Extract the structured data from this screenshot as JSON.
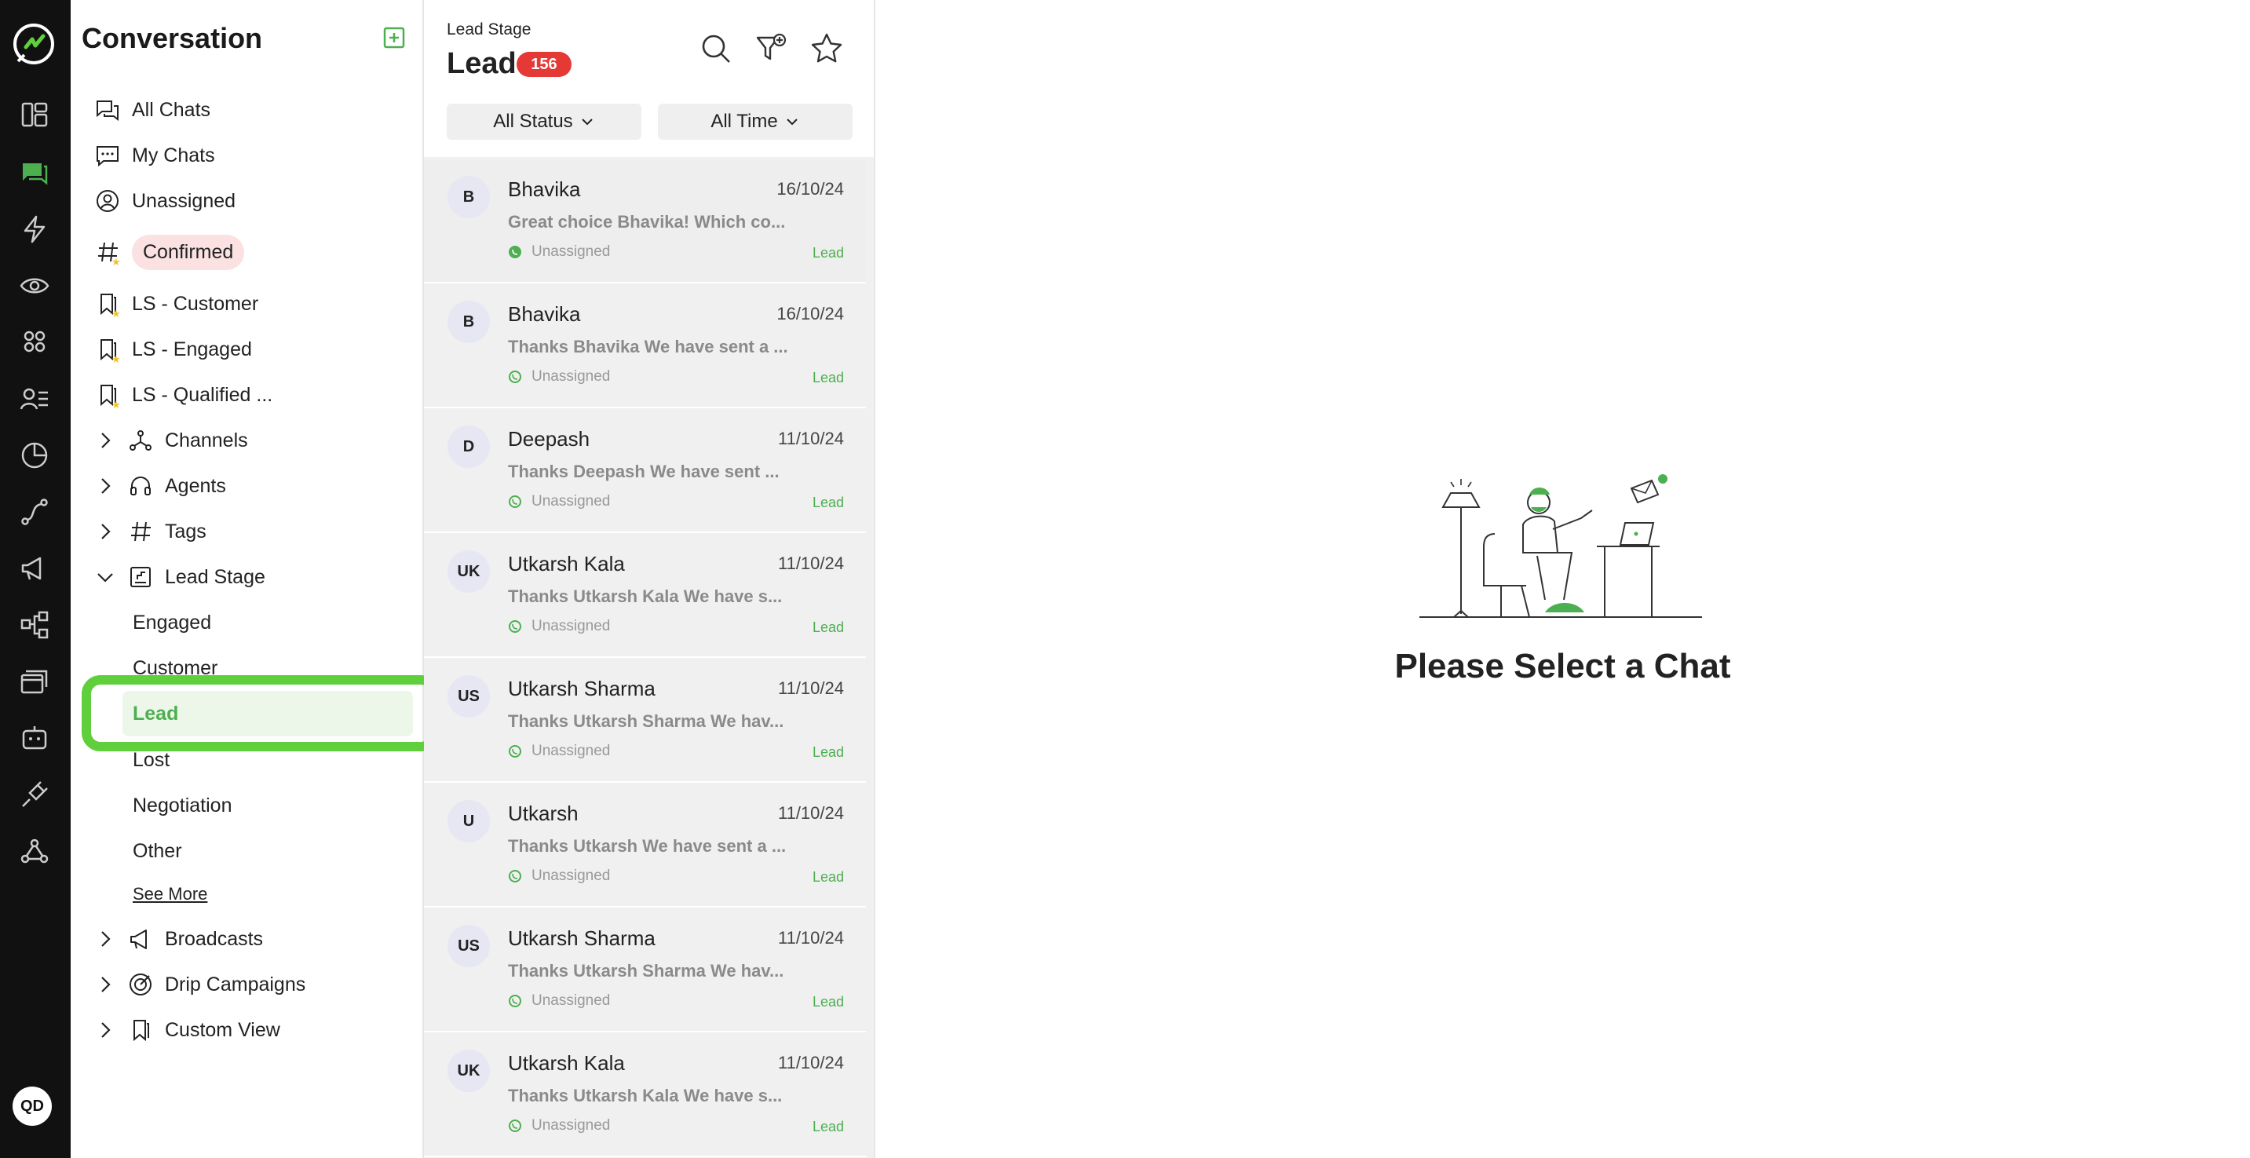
{
  "sidebar": {
    "title": "Conversation",
    "items": [
      {
        "label": "All Chats"
      },
      {
        "label": "My Chats"
      },
      {
        "label": "Unassigned"
      },
      {
        "label": "Confirmed"
      },
      {
        "label": "LS - Customer"
      },
      {
        "label": "LS - Engaged"
      },
      {
        "label": "LS - Qualified ..."
      },
      {
        "label": "Channels"
      },
      {
        "label": "Agents"
      },
      {
        "label": "Tags"
      },
      {
        "label": "Lead Stage"
      }
    ],
    "lead_stages": [
      "Engaged",
      "Customer",
      "Lead",
      "Lost",
      "Negotiation",
      "Other"
    ],
    "see_more": "See More",
    "bottom_items": [
      {
        "label": "Broadcasts"
      },
      {
        "label": "Drip Campaigns"
      },
      {
        "label": "Custom View"
      }
    ]
  },
  "rail": {
    "avatar": "QD"
  },
  "list": {
    "subtitle": "Lead Stage",
    "title": "Lead",
    "count": "156",
    "status_filter": "All Status",
    "time_filter": "All Time",
    "chats": [
      {
        "initials": "B",
        "name": "Bhavika",
        "date": "16/10/24",
        "preview": "Great choice Bhavika! Which co...",
        "status": "Unassigned",
        "tag": "Lead"
      },
      {
        "initials": "B",
        "name": "Bhavika",
        "date": "16/10/24",
        "preview": "Thanks Bhavika We have sent a ...",
        "status": "Unassigned",
        "tag": "Lead"
      },
      {
        "initials": "D",
        "name": "Deepash",
        "date": "11/10/24",
        "preview": "Thanks Deepash We have sent ...",
        "status": "Unassigned",
        "tag": "Lead"
      },
      {
        "initials": "UK",
        "name": "Utkarsh Kala",
        "date": "11/10/24",
        "preview": "Thanks Utkarsh Kala We have s...",
        "status": "Unassigned",
        "tag": "Lead"
      },
      {
        "initials": "US",
        "name": "Utkarsh Sharma",
        "date": "11/10/24",
        "preview": "Thanks Utkarsh Sharma We hav...",
        "status": "Unassigned",
        "tag": "Lead"
      },
      {
        "initials": "U",
        "name": "Utkarsh",
        "date": "11/10/24",
        "preview": "Thanks Utkarsh We have sent a ...",
        "status": "Unassigned",
        "tag": "Lead"
      },
      {
        "initials": "US",
        "name": "Utkarsh Sharma",
        "date": "11/10/24",
        "preview": "Thanks Utkarsh Sharma We hav...",
        "status": "Unassigned",
        "tag": "Lead"
      },
      {
        "initials": "UK",
        "name": "Utkarsh Kala",
        "date": "11/10/24",
        "preview": "Thanks Utkarsh Kala We have s...",
        "status": "Unassigned",
        "tag": "Lead"
      }
    ]
  },
  "main": {
    "empty_text": "Please Select a Chat"
  },
  "colors": {
    "accent": "#4caf50",
    "highlight": "#5fcf3b",
    "badge": "#e53935",
    "rail": "#111111"
  }
}
